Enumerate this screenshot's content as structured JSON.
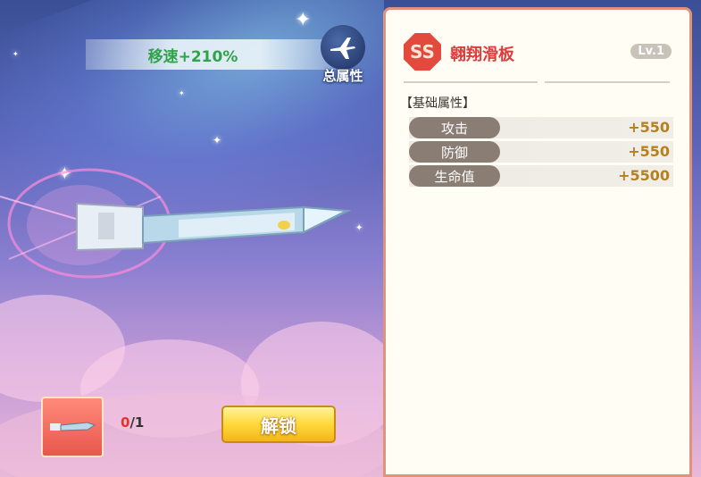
{
  "banner": {
    "speed_text": "移速+210%"
  },
  "total_attr": {
    "label": "总属性",
    "icon": "airplane-icon"
  },
  "item_slot": {
    "icon": "skateboard-icon",
    "count_current": "0",
    "count_total": "/1"
  },
  "unlock_button": {
    "label": "解锁"
  },
  "panel": {
    "rarity": "SS",
    "name": "翱翔滑板",
    "level": "Lv.1",
    "section_title": "【基础属性】",
    "stats": [
      {
        "label": "攻击",
        "value": "+550"
      },
      {
        "label": "防御",
        "value": "+550"
      },
      {
        "label": "生命值",
        "value": "+5500"
      }
    ]
  },
  "colors": {
    "speed_text": "#2fa34a",
    "name": "#e13a3a",
    "stat_value": "#b7801f",
    "panel_border": "#e0937a"
  }
}
